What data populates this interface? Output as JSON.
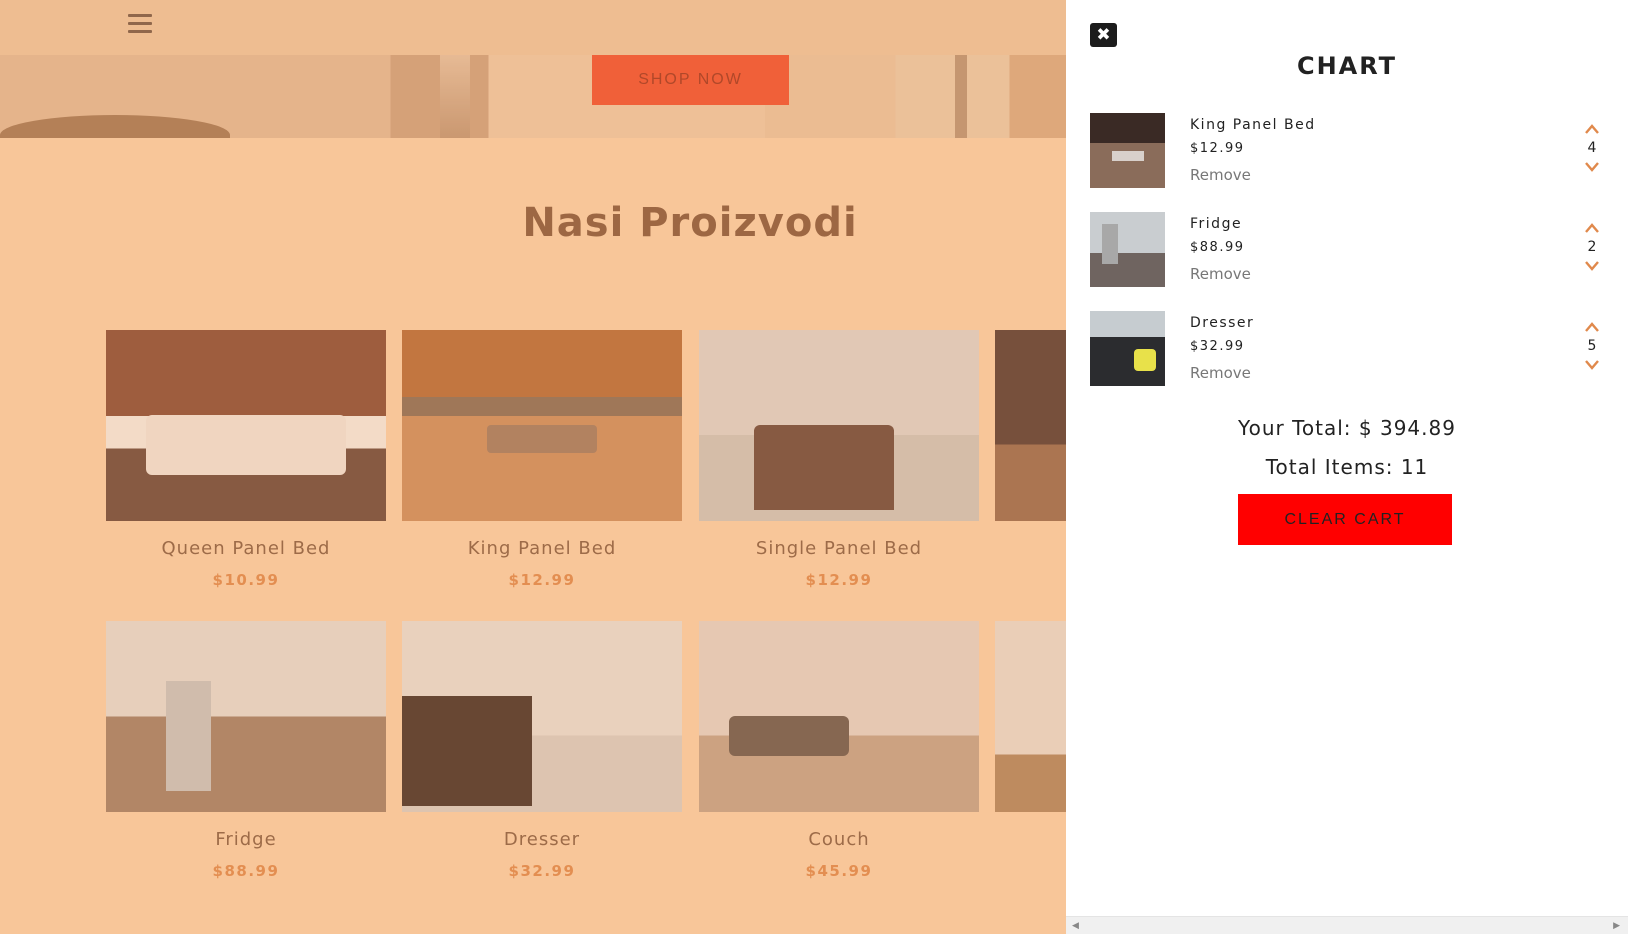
{
  "navbar": {
    "menu_icon": "hamburger-icon"
  },
  "hero": {
    "cta_label": "SHOP NOW"
  },
  "products_section": {
    "title": "Nasi Proizvodi",
    "products": [
      {
        "name": "Queen Panel Bed",
        "price": "$10.99"
      },
      {
        "name": "King Panel Bed",
        "price": "$12.99"
      },
      {
        "name": "Single Panel Bed",
        "price": "$12.99"
      },
      {
        "name": "Fridge",
        "price": "$88.99"
      },
      {
        "name": "Dresser",
        "price": "$32.99"
      },
      {
        "name": "Couch",
        "price": "$45.99"
      }
    ]
  },
  "cart": {
    "close_icon": "close-icon",
    "title": "CHART",
    "items": [
      {
        "name": "King Panel Bed",
        "price": "$12.99",
        "remove_label": "Remove",
        "quantity": "4"
      },
      {
        "name": "Fridge",
        "price": "$88.99",
        "remove_label": "Remove",
        "quantity": "2"
      },
      {
        "name": "Dresser",
        "price": "$32.99",
        "remove_label": "Remove",
        "quantity": "5"
      }
    ],
    "total_text": "Your Total: $ 394.89",
    "items_text": "Total Items: 11",
    "clear_label": "CLEAR CART"
  },
  "colors": {
    "accent": "#f0512f",
    "clear_button": "#ff0000",
    "page_bg": "#f9cda4",
    "price": "#e0894c",
    "chevron": "#e0894c"
  }
}
